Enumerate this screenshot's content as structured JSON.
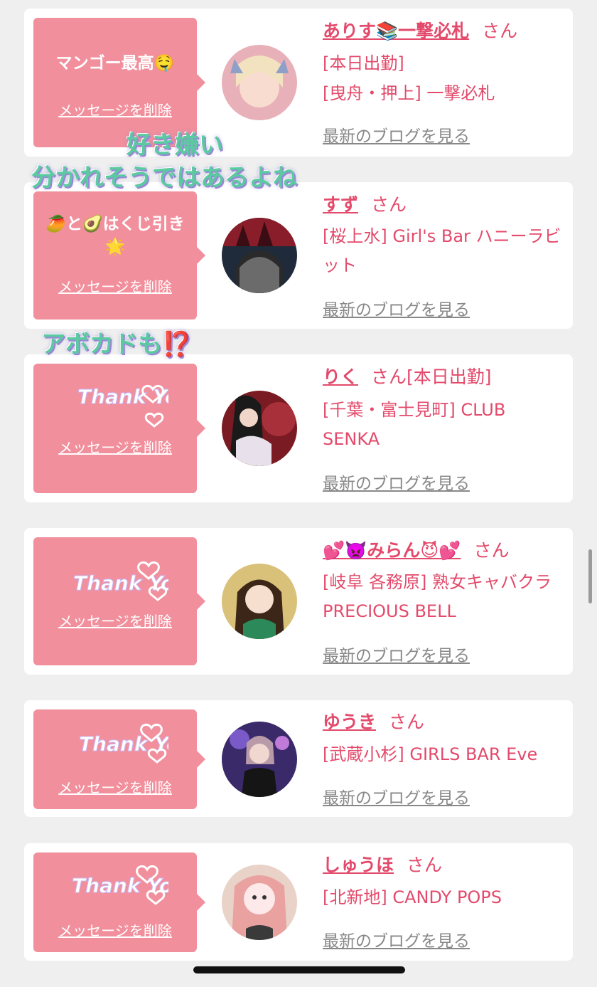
{
  "overlays": {
    "line1": "好き嫌い",
    "line2": "分かれそうではあるよね",
    "line3": "アボカドも⁉️"
  },
  "cards": [
    {
      "message": "マンゴー最高🤤",
      "delete_label": "メッセージを削除",
      "name": "ありす📚一撃必札",
      "honorific": "さん",
      "line1": "[本日出勤]",
      "line2": "[曳舟・押上] 一撃必札",
      "blog_label": "最新のブログを見る"
    },
    {
      "message": "🥭と🥑はくじ引き🌟",
      "delete_label": "メッセージを削除",
      "name": "すず",
      "honorific": "さん",
      "line1": "[桜上水] Girl's Bar ハニーラビット",
      "blog_label": "最新のブログを見る"
    },
    {
      "sticker": "Thank You",
      "delete_label": "メッセージを削除",
      "name": "りく",
      "honorific": "さん[本日出勤]",
      "line1": "[千葉・富士見町] CLUB SENKA",
      "blog_label": "最新のブログを見る"
    },
    {
      "sticker": "Thank You",
      "delete_label": "メッセージを削除",
      "name": "💕👿みらん😈💕",
      "honorific": "さん",
      "line1": "[岐阜 各務原] 熟女キャバクラ PRECIOUS BELL",
      "blog_label": "最新のブログを見る"
    },
    {
      "sticker": "Thank You",
      "delete_label": "メッセージを削除",
      "name": "ゆうき",
      "honorific": "さん",
      "line1": "[武蔵小杉] GIRLS BAR Eve",
      "blog_label": "最新のブログを見る"
    },
    {
      "sticker": "Thank You",
      "delete_label": "メッセージを削除",
      "name": "しゅうほ",
      "honorific": "さん",
      "line1": "[北新地] CANDY POPS",
      "blog_label": "最新のブログを見る"
    }
  ]
}
